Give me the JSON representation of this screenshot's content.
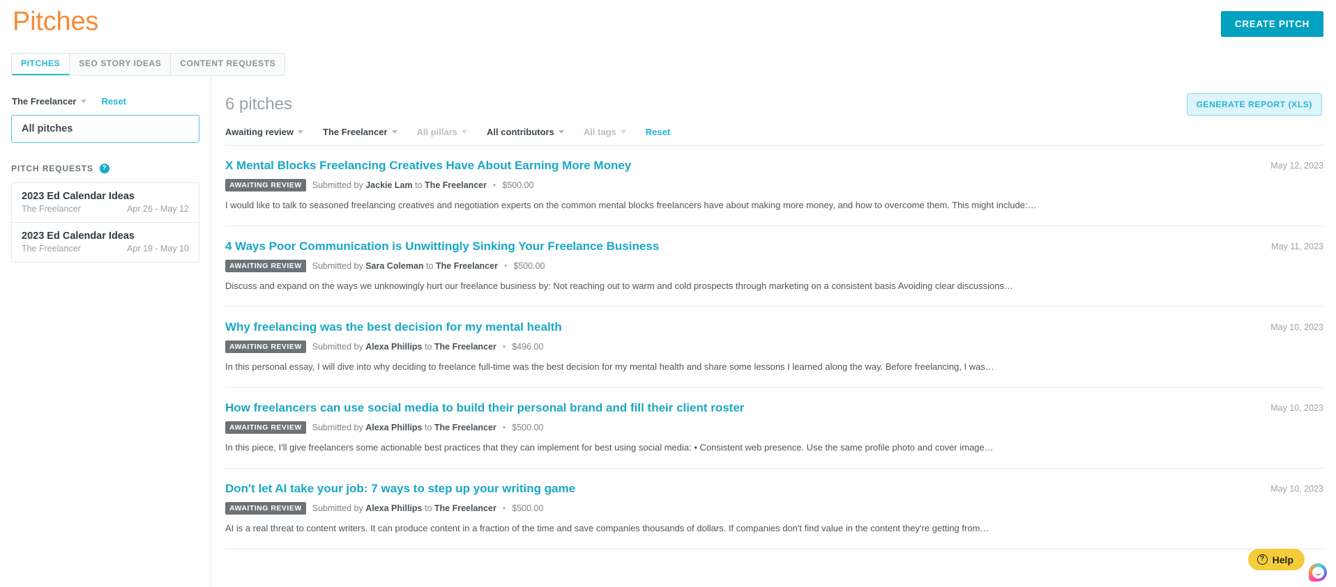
{
  "header": {
    "title": "Pitches",
    "create_button": "CREATE PITCH"
  },
  "tabs": [
    {
      "label": "PITCHES",
      "active": true
    },
    {
      "label": "SEO STORY IDEAS",
      "active": false
    },
    {
      "label": "CONTENT REQUESTS",
      "active": false
    }
  ],
  "sidebar": {
    "publication_filter": "The Freelancer",
    "reset_label": "Reset",
    "all_pitches_label": "All pitches",
    "pitch_requests_label": "PITCH REQUESTS",
    "help_icon": "question-mark-icon",
    "requests": [
      {
        "title": "2023 Ed Calendar Ideas",
        "publication": "The Freelancer",
        "dates": "Apr 26 - May 12"
      },
      {
        "title": "2023 Ed Calendar Ideas",
        "publication": "The Freelancer",
        "dates": "Apr 19 - May 10"
      }
    ]
  },
  "main": {
    "count_label": "6 pitches",
    "report_button": "GENERATE REPORT (XLS)",
    "filters": [
      {
        "label": "Awaiting review",
        "muted": false
      },
      {
        "label": "The Freelancer",
        "muted": false
      },
      {
        "label": "All pillars",
        "muted": true
      },
      {
        "label": "All contributors",
        "muted": false
      },
      {
        "label": "All tags",
        "muted": true
      }
    ],
    "filter_reset": "Reset",
    "pitches": [
      {
        "title": "X Mental Blocks Freelancing Creatives Have About Earning More Money",
        "date": "May 12, 2023",
        "status": "AWAITING REVIEW",
        "submitted_prefix": "Submitted by",
        "author": "Jackie Lam",
        "to_label": "to",
        "publication": "The Freelancer",
        "separator": "•",
        "amount": "$500.00",
        "description": "I would like to talk to seasoned freelancing creatives and negotiation experts on the common mental blocks freelancers have about making more money, and how to overcome them. This might include:…"
      },
      {
        "title": "4 Ways Poor Communication is Unwittingly Sinking Your Freelance Business",
        "date": "May 11, 2023",
        "status": "AWAITING REVIEW",
        "submitted_prefix": "Submitted by",
        "author": "Sara Coleman",
        "to_label": "to",
        "publication": "The Freelancer",
        "separator": "•",
        "amount": "$500.00",
        "description": "Discuss and expand on the ways we unknowingly hurt our freelance business by: Not reaching out to warm and cold prospects through marketing on a consistent basis Avoiding clear discussions…"
      },
      {
        "title": "Why freelancing was the best decision for my mental health",
        "date": "May 10, 2023",
        "status": "AWAITING REVIEW",
        "submitted_prefix": "Submitted by",
        "author": "Alexa Phillips",
        "to_label": "to",
        "publication": "The Freelancer",
        "separator": "•",
        "amount": "$496.00",
        "description": "In this personal essay, I will dive into why deciding to freelance full-time was the best decision for my mental health and share some lessons I learned along the way. Before freelancing, I was…"
      },
      {
        "title": "How freelancers can use social media to build their personal brand and fill their client roster",
        "date": "May 10, 2023",
        "status": "AWAITING REVIEW",
        "submitted_prefix": "Submitted by",
        "author": "Alexa Phillips",
        "to_label": "to",
        "publication": "The Freelancer",
        "separator": "•",
        "amount": "$500.00",
        "description": "In this piece, I'll give freelancers some actionable best practices that they can implement for best using social media: • Consistent web presence. Use the same profile photo and cover image…"
      },
      {
        "title": "Don't let AI take your job: 7 ways to step up your writing game",
        "date": "May 10, 2023",
        "status": "AWAITING REVIEW",
        "submitted_prefix": "Submitted by",
        "author": "Alexa Phillips",
        "to_label": "to",
        "publication": "The Freelancer",
        "separator": "•",
        "amount": "$500.00",
        "description": "AI is a real threat to content writers. It can produce content in a fraction of the time and save companies thousands of dollars. If companies don't find value in the content they're getting from…"
      }
    ]
  },
  "help_widget": {
    "label": "Help",
    "icon": "question-circle-icon"
  },
  "colors": {
    "brand_orange": "#f58a33",
    "teal": "#00a2bf",
    "link_teal": "#1aa7c4",
    "badge_gray": "#6b7378",
    "help_yellow": "#f5cd3a"
  }
}
